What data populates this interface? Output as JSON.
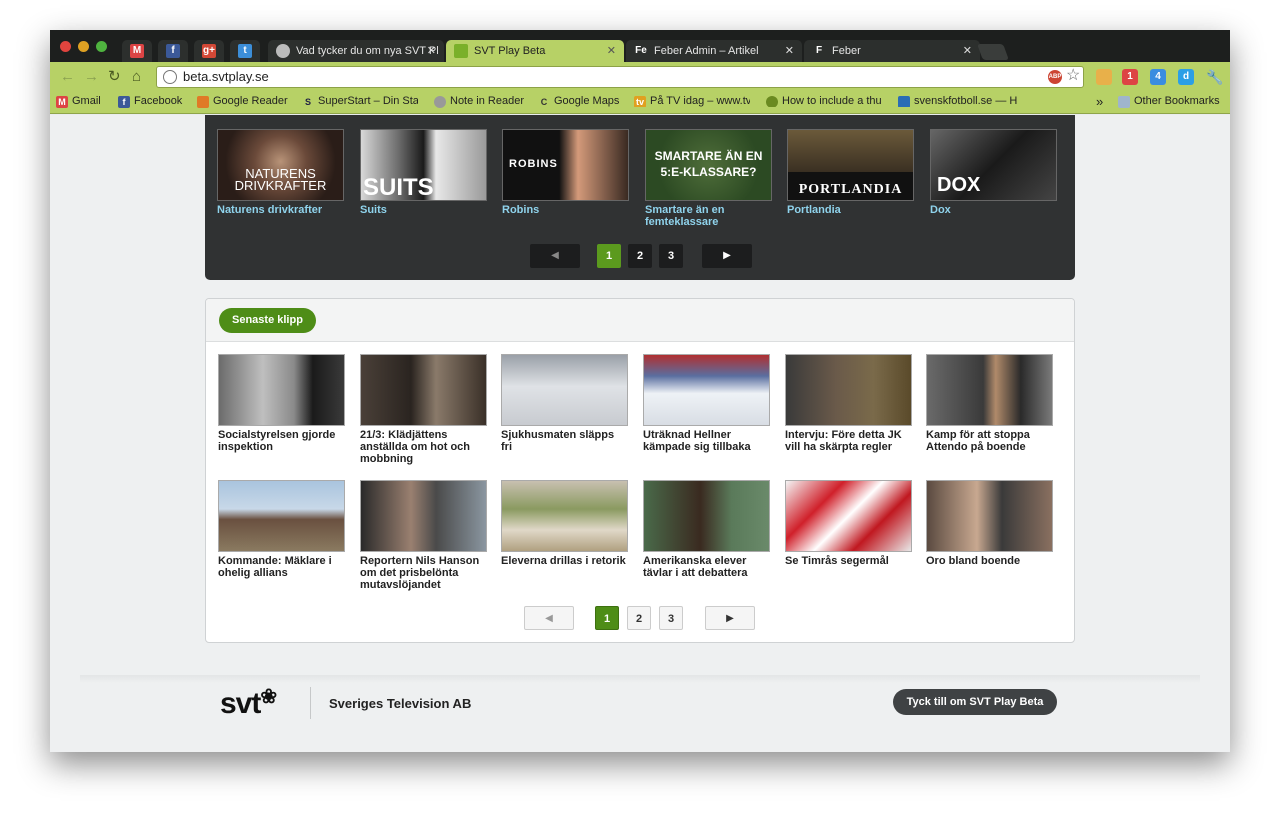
{
  "browser": {
    "tabs": [
      {
        "label": "Vad tycker du om nya SVT Pl"
      },
      {
        "label": "SVT Play Beta"
      },
      {
        "label": "Feber Admin – Artikel"
      },
      {
        "label": "Feber"
      }
    ],
    "favicon_letters": {
      "feber_admin": "Fe",
      "feber": "F"
    },
    "url": "beta.svtplay.se",
    "abp_badge": "ABP",
    "ext_badge_count": "4",
    "ext_gmail_count": "1",
    "bookmarks": [
      {
        "label": "Gmail"
      },
      {
        "label": "Facebook"
      },
      {
        "label": "Google Reader"
      },
      {
        "label": "SuperStart – Din Sta"
      },
      {
        "label": "Note in Reader"
      },
      {
        "label": "Google Maps"
      },
      {
        "label": "På TV idag – www.tv"
      },
      {
        "label": "How to include a thu"
      },
      {
        "label": "svenskfotboll.se — H"
      }
    ],
    "other_bookmarks": "Other Bookmarks"
  },
  "shows": {
    "items": [
      {
        "title": "Naturens drivkrafter",
        "art": "NATURENS DRIVKRAFTER"
      },
      {
        "title": "Suits",
        "art": "SUITS"
      },
      {
        "title": "Robins",
        "art": "ROBINS"
      },
      {
        "title": "Smartare än en femteklassare",
        "art": "SMARTARE ÄN EN 5:E-KLASSARE?"
      },
      {
        "title": "Portlandia",
        "art": "PORTLANDIA"
      },
      {
        "title": "Dox",
        "art": "DOX"
      }
    ],
    "pager": {
      "pages": [
        "1",
        "2",
        "3"
      ]
    }
  },
  "clips": {
    "header_label": "Senaste klipp",
    "items": [
      {
        "title": "Socialstyrelsen gjorde inspektion"
      },
      {
        "title": "21/3: Klädjättens anställda om hot och mobbning"
      },
      {
        "title": "Sjukhusmaten släpps fri"
      },
      {
        "title": "Uträknad Hellner kämpade sig tillbaka"
      },
      {
        "title": "Intervju: Före detta JK vill ha skärpta regler"
      },
      {
        "title": "Kamp för att stoppa Attendo på boende"
      },
      {
        "title": "Kommande: Mäklare i ohelig allians"
      },
      {
        "title": "Reportern Nils Hanson om det prisbelönta mutavslöjandet"
      },
      {
        "title": "Eleverna drillas i retorik"
      },
      {
        "title": "Amerikanska elever tävlar i att debattera"
      },
      {
        "title": "Se Timrås segermål"
      },
      {
        "title": "Oro bland boende"
      }
    ],
    "pager": {
      "pages": [
        "1",
        "2",
        "3"
      ]
    }
  },
  "footer": {
    "logo": "svt",
    "company": "Sveriges Television AB",
    "feedback_button": "Tyck till om SVT Play Beta"
  },
  "colors": {
    "accent_green": "#4e8d17",
    "chrome_green": "#b7d166",
    "dark_panel": "#303233",
    "show_title": "#8fd3ec"
  }
}
